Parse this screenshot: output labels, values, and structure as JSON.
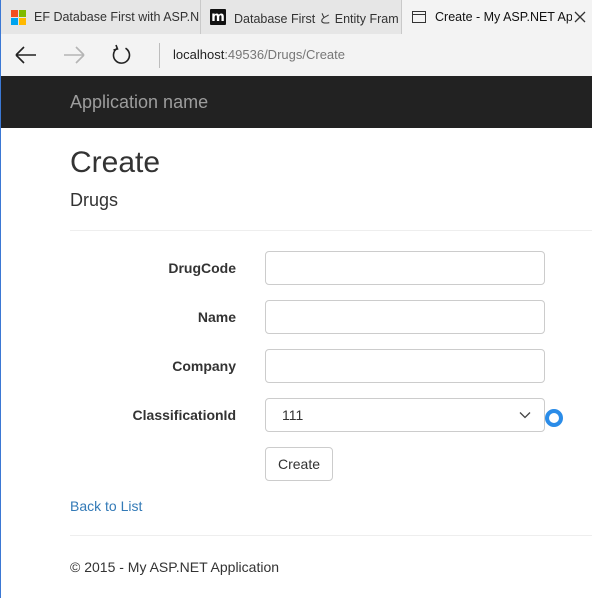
{
  "browser": {
    "tabs": [
      {
        "title": "EF Database First with ASP.N",
        "icon": "microsoft-logo-icon"
      },
      {
        "title": "Database First と Entity Fram",
        "icon": "m-logo-icon"
      },
      {
        "title": "Create - My ASP.NET Ap",
        "icon": "page-icon",
        "active": true
      }
    ],
    "address": {
      "host": "localhost",
      "rest": ":49536/Drugs/Create"
    }
  },
  "site": {
    "brand": "Application name"
  },
  "page": {
    "title": "Create",
    "subtitle": "Drugs",
    "fields": [
      {
        "label": "DrugCode",
        "value": ""
      },
      {
        "label": "Name",
        "value": ""
      },
      {
        "label": "Company",
        "value": ""
      }
    ],
    "classification": {
      "label": "ClassificationId",
      "selected": "111"
    },
    "create_label": "Create",
    "back_link": "Back to List",
    "footer": "© 2015 - My ASP.NET Application"
  },
  "colors": {
    "navbar_bg": "#222222",
    "brand_text": "#9d9d9d",
    "link": "#337ab7",
    "spinner": "#2b8ce8"
  }
}
